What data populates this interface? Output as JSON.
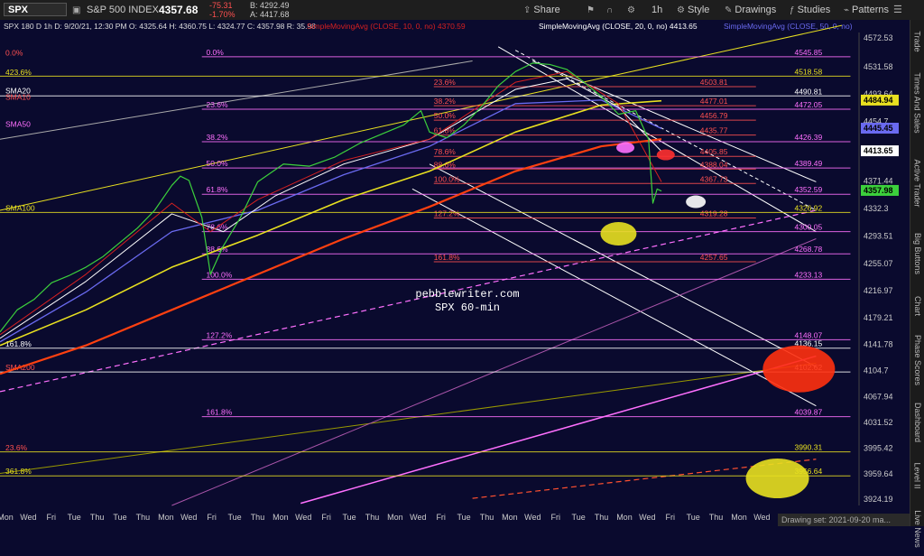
{
  "toolbar": {
    "symbol": "SPX",
    "name": "S&P 500 INDEX",
    "price": "4357.68",
    "change": "-75.31",
    "change_pct": "-1.70%",
    "bid": "B: 4292.49",
    "ask": "A: 4417.68",
    "share": "Share",
    "timeframe": "1h",
    "style": "Style",
    "drawings": "Drawings",
    "studies": "Studies",
    "patterns": "Patterns"
  },
  "chart_header": {
    "desc": "SPX 180 D 1h   D: 9/20/21, 12:30 PM  O: 4325.64  H: 4360.75  L: 4324.77  C: 4357.98  R: 35.98",
    "sma10": "SimpleMovingAvg (CLOSE, 10, 0, no)  4370.59",
    "sma20": "SimpleMovingAvg (CLOSE, 20, 0, no)  4413.65",
    "sma50": "SimpleMovingAvg (CLOSE, 50, 0, no)"
  },
  "watermark": {
    "line1": "pebblewriter.com",
    "line2": "SPX 60-min"
  },
  "drawing_set": "Drawing set:  2021-09-20 ma...",
  "sidebar": [
    "Trade",
    "Times And Sales",
    "Active Trader",
    "Big Buttons",
    "Chart",
    "Phase Scores",
    "Dashboard",
    "Level II",
    "Live News"
  ],
  "colors": {
    "background": "#0a0a2e",
    "sma10": "#d62020",
    "sma20": "#ffffff",
    "sma50": "#6a6af0",
    "sma100": "#e8e020",
    "sma200": "#ff4010",
    "fib_pink": "#ff70ff",
    "fib_yellow": "#e8e020",
    "fib_red": "#ff5050"
  },
  "chart_data": {
    "type": "line",
    "title": "",
    "ylim": [
      3915,
      4580
    ],
    "y_ticks": [
      "4572.53",
      "4531.58",
      "4493.64",
      "4454.7",
      "4413.65",
      "4371.44",
      "4332.3",
      "4293.51",
      "4255.07",
      "4216.97",
      "4179.21",
      "4141.78",
      "4104.7",
      "4067.94",
      "4031.52",
      "3995.42",
      "3959.64",
      "3924.19"
    ],
    "x_labels": [
      "Mon",
      "Wed",
      "Fri",
      "Tue",
      "Thu",
      "Tue",
      "Thu",
      "Mon",
      "Wed",
      "Fri",
      "Tue",
      "Thu",
      "Mon",
      "Wed",
      "Fri",
      "Tue",
      "Thu",
      "Mon",
      "Wed",
      "Fri",
      "Tue",
      "Thu",
      "Mon",
      "Wed",
      "Fri",
      "Tue",
      "Thu",
      "Mon",
      "Wed",
      "Fri",
      "Tue",
      "Thu",
      "Mon",
      "Wed",
      "Fri",
      "Tue",
      "Thu",
      "Mon"
    ],
    "price_badges": [
      {
        "value": "4484.94",
        "color": "#e8e020"
      },
      {
        "value": "4445.45",
        "color": "#6a6af0"
      },
      {
        "value": "4413.65",
        "color": "#ffffff"
      },
      {
        "value": "4357.98",
        "color": "#3cd03c"
      }
    ],
    "left_labels": [
      {
        "text": "0.0%",
        "y": 4545,
        "color": "#ff5050"
      },
      {
        "text": "423.6%",
        "y": 4518,
        "color": "#e8e020"
      },
      {
        "text": "SMA20",
        "y": 4492,
        "color": "#ffffff"
      },
      {
        "text": "SMA10",
        "y": 4483,
        "color": "#ff5050"
      },
      {
        "text": "SMA50",
        "y": 4445,
        "color": "#ff70ff"
      },
      {
        "text": "SMA100",
        "y": 4327,
        "color": "#e8e020"
      },
      {
        "text": "161.8%",
        "y": 4136,
        "color": "#ffffff"
      },
      {
        "text": "SMA200",
        "y": 4103,
        "color": "#ff5050"
      },
      {
        "text": "23.6%",
        "y": 3990,
        "color": "#ff5050"
      },
      {
        "text": "361.8%",
        "y": 3957,
        "color": "#e8e020"
      }
    ],
    "fib_pink": [
      {
        "label": "0.0%",
        "y": 4545.85
      },
      {
        "label": "23.6%",
        "y": 4472.05
      },
      {
        "label": "38.2%",
        "y": 4426.39
      },
      {
        "label": "50.0%",
        "y": 4389.49
      },
      {
        "label": "61.8%",
        "y": 4352.59
      },
      {
        "label": "78.6%",
        "y": 4300.05
      },
      {
        "label": "88.6%",
        "y": 4268.78
      },
      {
        "label": "100.0%",
        "y": 4233.13
      },
      {
        "label": "127.2%",
        "y": 4148.07
      },
      {
        "label": "161.8%",
        "y": 4039.87
      }
    ],
    "fib_red": [
      {
        "label": "23.6%",
        "y": 4503.81
      },
      {
        "label": "38.2%",
        "y": 4477.01
      },
      {
        "label": "50.0%",
        "y": 4456.79
      },
      {
        "label": "61.8%",
        "y": 4435.77
      },
      {
        "label": "78.6%",
        "y": 4405.85
      },
      {
        "label": "88.6%",
        "y": 4388.04
      },
      {
        "label": "100.0%",
        "y": 4367.73
      },
      {
        "label": "127.2%",
        "y": 4319.28
      },
      {
        "label": "161.8%",
        "y": 4257.65
      }
    ],
    "fib_white": [
      {
        "label": "",
        "y": 4490.81
      },
      {
        "label": "",
        "y": 4136.15
      },
      {
        "label": "",
        "y": 4102.62
      }
    ],
    "fib_yellow": [
      {
        "label": "",
        "y": 4518.58
      },
      {
        "label": "",
        "y": 4326.92
      },
      {
        "label": "",
        "y": 3990.31
      },
      {
        "label": "",
        "y": 3956.64
      }
    ],
    "price_series": [
      [
        0,
        4159
      ],
      [
        0.02,
        4190
      ],
      [
        0.04,
        4205
      ],
      [
        0.06,
        4228
      ],
      [
        0.08,
        4238
      ],
      [
        0.1,
        4250
      ],
      [
        0.12,
        4265
      ],
      [
        0.14,
        4285
      ],
      [
        0.16,
        4305
      ],
      [
        0.18,
        4330
      ],
      [
        0.2,
        4365
      ],
      [
        0.21,
        4378
      ],
      [
        0.22,
        4372
      ],
      [
        0.235,
        4320
      ],
      [
        0.245,
        4240
      ],
      [
        0.26,
        4280
      ],
      [
        0.28,
        4320
      ],
      [
        0.3,
        4370
      ],
      [
        0.33,
        4395
      ],
      [
        0.36,
        4392
      ],
      [
        0.39,
        4405
      ],
      [
        0.42,
        4425
      ],
      [
        0.45,
        4440
      ],
      [
        0.47,
        4450
      ],
      [
        0.49,
        4470
      ],
      [
        0.5,
        4440
      ],
      [
        0.52,
        4432
      ],
      [
        0.54,
        4450
      ],
      [
        0.56,
        4475
      ],
      [
        0.58,
        4505
      ],
      [
        0.6,
        4525
      ],
      [
        0.62,
        4537
      ],
      [
        0.64,
        4535
      ],
      [
        0.66,
        4528
      ],
      [
        0.68,
        4510
      ],
      [
        0.7,
        4490
      ],
      [
        0.72,
        4465
      ],
      [
        0.74,
        4470
      ],
      [
        0.755,
        4430
      ],
      [
        0.76,
        4340
      ],
      [
        0.765,
        4360
      ],
      [
        0.77,
        4357
      ]
    ],
    "sma10_series": [
      [
        0,
        4155
      ],
      [
        0.1,
        4240
      ],
      [
        0.2,
        4340
      ],
      [
        0.245,
        4300
      ],
      [
        0.3,
        4345
      ],
      [
        0.4,
        4400
      ],
      [
        0.5,
        4430
      ],
      [
        0.6,
        4510
      ],
      [
        0.66,
        4525
      ],
      [
        0.72,
        4480
      ],
      [
        0.77,
        4370
      ]
    ],
    "sma20_series": [
      [
        0,
        4150
      ],
      [
        0.1,
        4230
      ],
      [
        0.2,
        4325
      ],
      [
        0.26,
        4300
      ],
      [
        0.32,
        4350
      ],
      [
        0.4,
        4395
      ],
      [
        0.5,
        4430
      ],
      [
        0.6,
        4500
      ],
      [
        0.66,
        4515
      ],
      [
        0.72,
        4475
      ],
      [
        0.77,
        4413
      ]
    ],
    "sma50_series": [
      [
        0,
        4145
      ],
      [
        0.1,
        4215
      ],
      [
        0.2,
        4300
      ],
      [
        0.3,
        4330
      ],
      [
        0.4,
        4380
      ],
      [
        0.5,
        4420
      ],
      [
        0.6,
        4480
      ],
      [
        0.7,
        4485
      ],
      [
        0.77,
        4445
      ]
    ],
    "sma100_series": [
      [
        0,
        4140
      ],
      [
        0.1,
        4190
      ],
      [
        0.2,
        4250
      ],
      [
        0.3,
        4295
      ],
      [
        0.4,
        4345
      ],
      [
        0.5,
        4385
      ],
      [
        0.6,
        4440
      ],
      [
        0.7,
        4478
      ],
      [
        0.77,
        4484
      ]
    ],
    "sma200_series": [
      [
        0,
        4100
      ],
      [
        0.1,
        4140
      ],
      [
        0.2,
        4190
      ],
      [
        0.3,
        4240
      ],
      [
        0.4,
        4290
      ],
      [
        0.5,
        4335
      ],
      [
        0.6,
        4385
      ],
      [
        0.7,
        4420
      ],
      [
        0.77,
        4430
      ]
    ],
    "targets": [
      {
        "color": "#ffffff",
        "y": 4342,
        "x": 0.81,
        "rx": 11,
        "ry": 7
      },
      {
        "color": "#ff3030",
        "y": 4408,
        "x": 0.775,
        "rx": 10,
        "ry": 6
      },
      {
        "color": "#ff70ff",
        "y": 4418,
        "x": 0.728,
        "rx": 10,
        "ry": 6
      },
      {
        "color": "#e8e020",
        "y": 4297,
        "x": 0.72,
        "rx": 20,
        "ry": 13
      },
      {
        "color": "#ff3010",
        "y": 4107,
        "x": 0.93,
        "rx": 40,
        "ry": 26
      },
      {
        "color": "#e8e020",
        "y": 3953,
        "x": 0.905,
        "rx": 35,
        "ry": 22
      }
    ]
  }
}
